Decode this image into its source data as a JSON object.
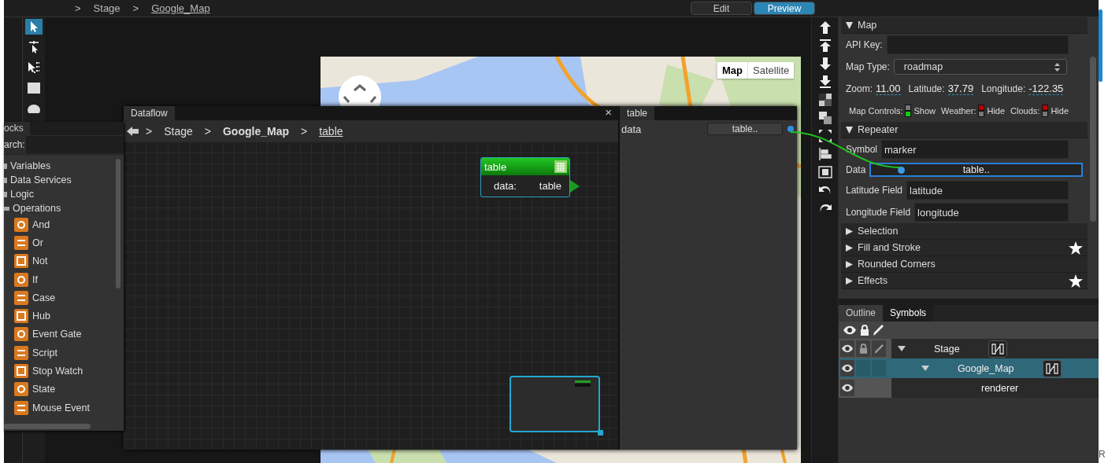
{
  "toolbar": {
    "breadcrumb": [
      {
        "kind": "sep",
        "text": ">"
      },
      {
        "kind": "crumb",
        "text": "Stage"
      },
      {
        "kind": "sep",
        "text": ">"
      },
      {
        "kind": "link",
        "text": "Google_Map"
      }
    ],
    "modes": [
      {
        "label": "Edit",
        "selected": false
      },
      {
        "label": "Preview",
        "selected": true
      }
    ]
  },
  "tools": [
    {
      "selected": true
    },
    {
      "selected": false
    },
    {
      "selected": false
    },
    {
      "selected": false
    },
    {
      "selected": false
    }
  ],
  "map_view": {
    "map_types": [
      {
        "label": "Map",
        "selected": true
      },
      {
        "label": "Satellite",
        "selected": false
      }
    ]
  },
  "dataflow": {
    "title": "Dataflow",
    "close": "×",
    "breadcrumb": [
      {
        "kind": "sep",
        "text": ">"
      },
      {
        "kind": "crumb",
        "text": "Stage"
      },
      {
        "kind": "sep",
        "text": ">"
      },
      {
        "kind": "strong",
        "text": "Google_Map"
      },
      {
        "kind": "sep",
        "text": ">"
      },
      {
        "kind": "link",
        "text": "table"
      }
    ],
    "node": {
      "title": "table",
      "port_label": "data:",
      "port_value": "table"
    },
    "inspector": {
      "tab": "table",
      "label": "data",
      "value": "table.."
    }
  },
  "blocks": {
    "tab": "ocks",
    "search_label": "arch:",
    "tree": [
      {
        "label": "Variables",
        "expanded": false
      },
      {
        "label": "Data Services",
        "expanded": false
      },
      {
        "label": "Logic",
        "expanded": false
      },
      {
        "label": "Operations",
        "expanded": true,
        "children": [
          {
            "label": "And"
          },
          {
            "label": "Or"
          },
          {
            "label": "Not"
          },
          {
            "label": "If"
          },
          {
            "label": "Case"
          },
          {
            "label": "Hub"
          },
          {
            "label": "Event Gate"
          },
          {
            "label": "Script"
          },
          {
            "label": "Stop Watch"
          },
          {
            "label": "State"
          },
          {
            "label": "Mouse Event"
          }
        ]
      }
    ]
  },
  "properties": {
    "map": {
      "title": "Map",
      "expanded": true,
      "api_key": {
        "label": "API Key:"
      },
      "map_type": {
        "label": "Map Type:",
        "value": "roadmap"
      },
      "position": [
        {
          "label": "Zoom:",
          "value": "11.00"
        },
        {
          "label": "Latitude:",
          "value": "37.79"
        },
        {
          "label": "Longitude:",
          "value": "-122.35"
        }
      ],
      "toggles": [
        {
          "label": "Map Controls:",
          "on": true,
          "state": "Show"
        },
        {
          "label": "Weather:",
          "on": false,
          "state": "Hide"
        },
        {
          "label": "Clouds:",
          "on": false,
          "state": "Hide"
        }
      ]
    },
    "repeater": {
      "title": "Repeater",
      "expanded": true,
      "fields": [
        {
          "label": "Symbol",
          "value": "marker",
          "kind": "text"
        },
        {
          "label": "Data",
          "value": "table..",
          "kind": "binding",
          "selected": true
        },
        {
          "label": "Latitude Field",
          "value": "latitude",
          "kind": "text"
        },
        {
          "label": "Longitude Field",
          "value": "longitude",
          "kind": "text"
        }
      ]
    },
    "sections": [
      {
        "title": "Selection",
        "expanded": false,
        "starred": false
      },
      {
        "title": "Fill and Stroke",
        "expanded": false,
        "starred": true
      },
      {
        "title": "Rounded Corners",
        "expanded": false,
        "starred": false
      },
      {
        "title": "Effects",
        "expanded": false,
        "starred": true
      }
    ]
  },
  "outline": {
    "tabs": [
      {
        "label": "Outline",
        "selected": true
      },
      {
        "label": "Symbols",
        "selected": false
      }
    ],
    "tree": [
      {
        "label": "Stage",
        "expanded": true,
        "selected": false,
        "locked": true,
        "symbol": true,
        "children": [
          {
            "label": "Google_Map",
            "expanded": true,
            "selected": true,
            "locked": false,
            "symbol": true,
            "children": [
              {
                "label": "renderer",
                "selected": false,
                "locked": false,
                "symbol": false
              }
            ]
          }
        ]
      }
    ]
  },
  "edge_text": "R"
}
